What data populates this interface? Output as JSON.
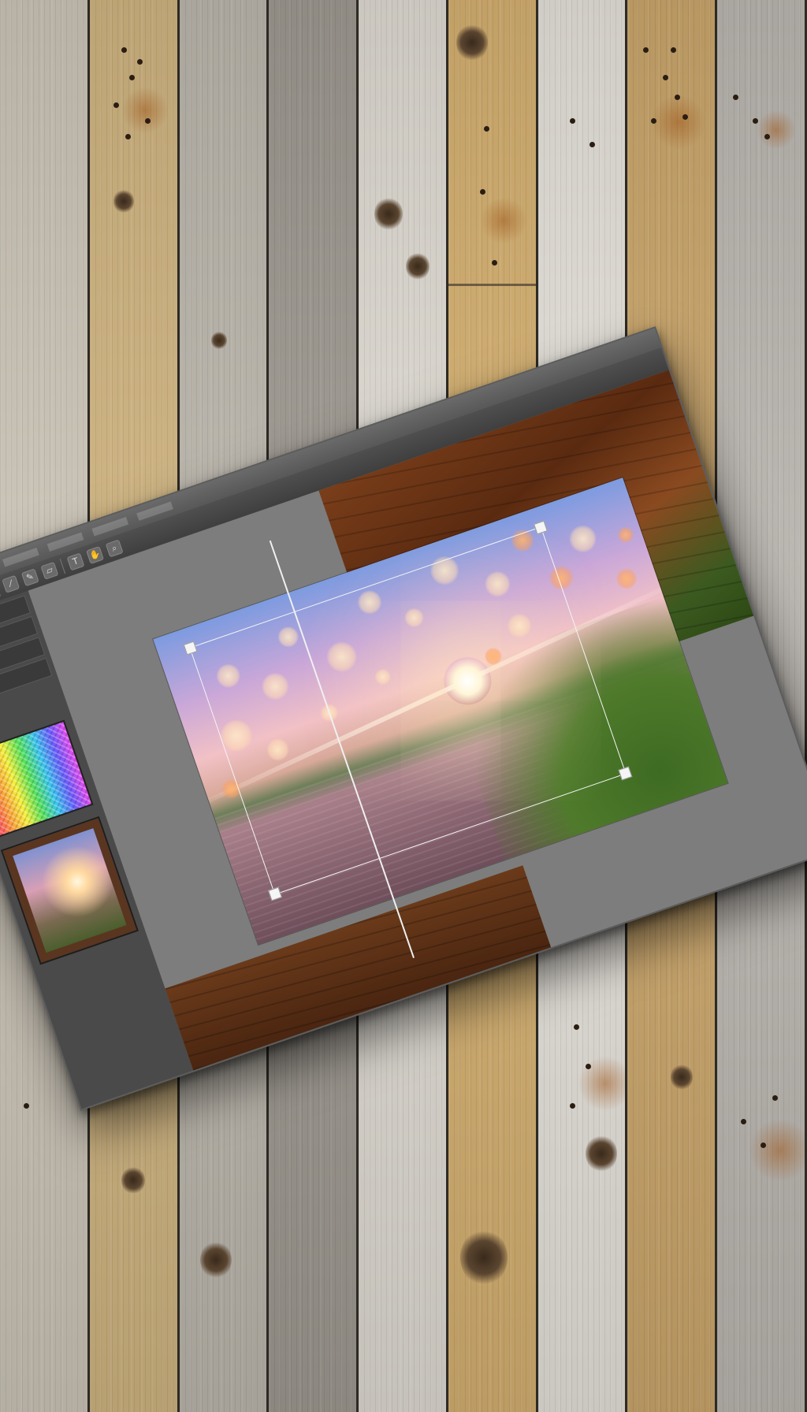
{
  "scene": {
    "background": "weathered wooden planks",
    "plank_colors": [
      "#c9c2b5",
      "#cdb27f",
      "#b9b4aa",
      "#9c978f",
      "#dcd8d0",
      "#d2ae6f",
      "#e2ded7",
      "#c8a46a",
      "#b8b4ae"
    ]
  },
  "app": {
    "menu": [
      "",
      "",
      "",
      "",
      "",
      ""
    ],
    "toolbar_icons": [
      "move-icon",
      "marquee-icon",
      "lasso-icon",
      "crop-icon",
      "eyedropper-icon",
      "brush-icon",
      "eraser-icon",
      "text-icon",
      "hand-icon",
      "zoom-icon"
    ],
    "left_panel": {
      "rows": [
        "",
        "",
        "",
        ""
      ],
      "swatch": "color picker (rainbow)",
      "thumbnail": "layer thumbnail"
    },
    "canvas": {
      "photo": "bokeh sunset over lake with grass",
      "crop_active": true
    },
    "colors": {
      "window_gray": "#7a7a7a",
      "panel_dark": "#4a4a4a",
      "crop_line": "#f4f4f4"
    }
  }
}
